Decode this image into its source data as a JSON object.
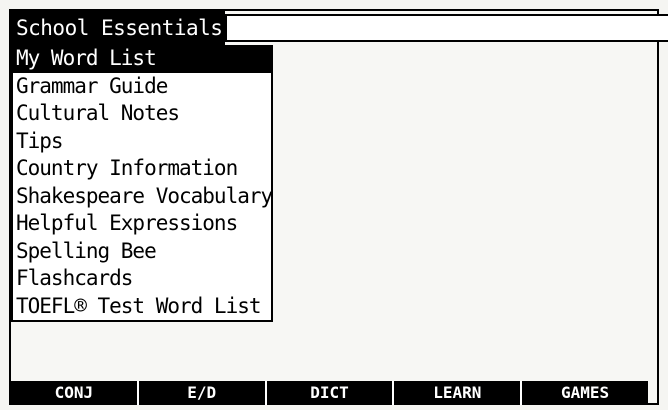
{
  "header": {
    "title": "School Essentials",
    "field_value": ""
  },
  "menu": {
    "selected_index": 0,
    "items": [
      {
        "label": "My Word List"
      },
      {
        "label": "Grammar Guide"
      },
      {
        "label": "Cultural Notes"
      },
      {
        "label": "Tips"
      },
      {
        "label": "Country Information"
      },
      {
        "label": "Shakespeare Vocabulary"
      },
      {
        "label": "Helpful Expressions"
      },
      {
        "label": "Spelling Bee"
      },
      {
        "label": "Flashcards"
      },
      {
        "label": "TOEFL® Test Word List"
      }
    ]
  },
  "softkeys": [
    {
      "label": "CONJ"
    },
    {
      "label": "E/D"
    },
    {
      "label": "DICT"
    },
    {
      "label": "LEARN"
    },
    {
      "label": "GAMES"
    }
  ]
}
